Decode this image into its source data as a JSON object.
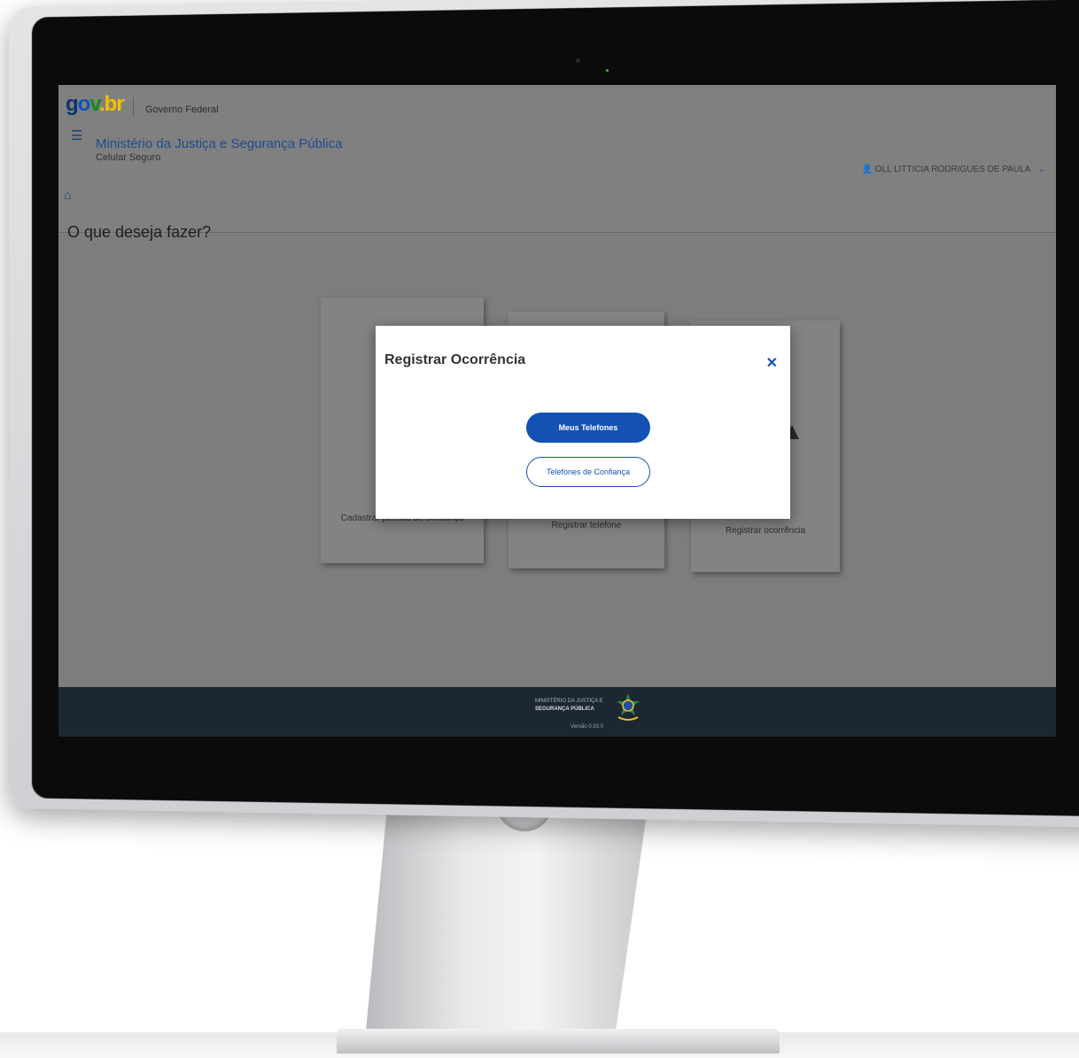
{
  "header": {
    "logo": {
      "g": "g",
      "o": "o",
      "v": "v",
      "br": ".br"
    },
    "government": "Governo Federal",
    "ministry": "Ministério da Justiça e Segurança Pública",
    "subtitle": "Celular Seguro",
    "user_name": "OLL LITTICIA RODRIGUES DE PAULA"
  },
  "main": {
    "title": "O que deseja fazer?",
    "cards": [
      {
        "label": "Cadastrar pessoa de confiança"
      },
      {
        "label": "Registrar telefone"
      },
      {
        "label": "Registrar ocorrência"
      }
    ]
  },
  "modal": {
    "title": "Registrar Ocorrência",
    "primary_button": "Meus Telefones",
    "secondary_button": "Telefones de Confiança"
  },
  "footer": {
    "line1": "MINISTÉRIO DA JUSTIÇA E",
    "line2": "SEGURANÇA PÚBLICA",
    "version": "Versão 0.93.0"
  },
  "colors": {
    "primary": "#1351b4",
    "footer_bg": "#1c2733",
    "overlay_bg": "#7d7d7d"
  },
  "icons": [
    "menu-icon",
    "home-icon",
    "user-icon",
    "chevron-down-icon",
    "close-icon",
    "coat-of-arms-icon"
  ]
}
